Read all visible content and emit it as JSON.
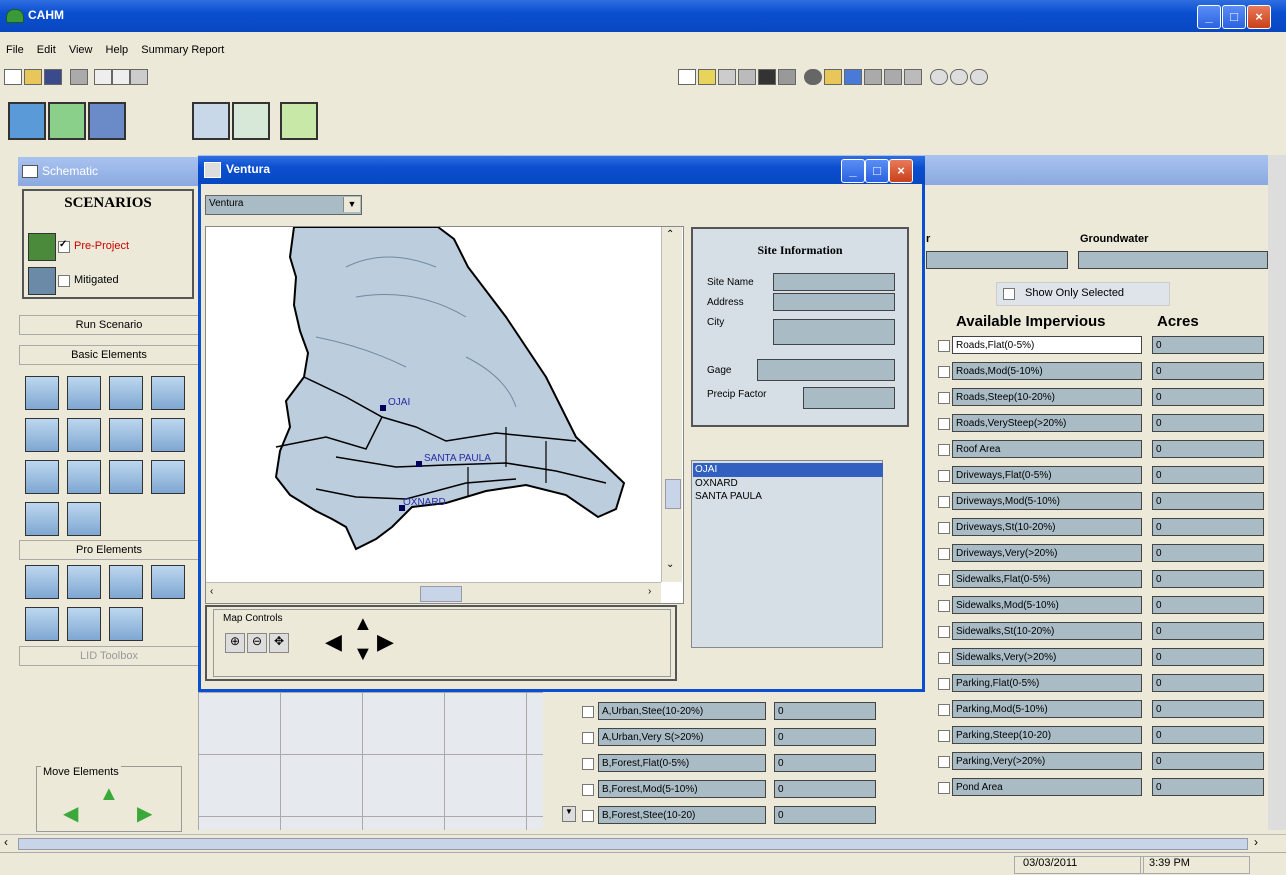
{
  "window": {
    "title": "CAHM"
  },
  "menu": [
    "File",
    "Edit",
    "View",
    "Help",
    "Summary Report"
  ],
  "left": {
    "header": "Schematic",
    "scenarios_title": "SCENARIOS",
    "scenarios": [
      {
        "label": "Pre-Project",
        "checked": true,
        "color": "#cc0000"
      },
      {
        "label": "Mitigated",
        "checked": false,
        "color": "#000000"
      }
    ],
    "run_label": "Run Scenario",
    "basic_label": "Basic Elements",
    "pro_label": "Pro Elements",
    "lid_label": "LID Toolbox",
    "move_label": "Move Elements"
  },
  "ventura": {
    "title": "Ventura",
    "dropdown_value": "Ventura",
    "site_info_title": "Site Information",
    "site_labels": [
      "Site Name",
      "Address",
      "City"
    ],
    "gage_label": "Gage",
    "precip_label": "Precip Factor",
    "map_controls_label": "Map Controls",
    "cities": [
      "OJAI",
      "OXNARD",
      "SANTA PAULA"
    ],
    "map_labels": [
      "OJAI",
      "SANTA PAULA",
      "OXNARD"
    ]
  },
  "main": {
    "col_partial": "r",
    "groundwater_label": "Groundwater",
    "show_only_selected": "Show Only Selected",
    "imperv_header": "Available Impervious",
    "acres_header": "Acres",
    "impervious": [
      "Roads,Flat(0-5%)",
      "Roads,Mod(5-10%)",
      "Roads,Steep(10-20%)",
      "Roads,VerySteep(>20%)",
      "Roof Area",
      "Driveways,Flat(0-5%)",
      "Driveways,Mod(5-10%)",
      "Driveways,St(10-20%)",
      "Driveways,Very(>20%)",
      "Sidewalks,Flat(0-5%)",
      "Sidewalks,Mod(5-10%)",
      "Sidewalks,St(10-20%)",
      "Sidewalks,Very(>20%)",
      "Parking,Flat(0-5%)",
      "Parking,Mod(5-10%)",
      "Parking,Steep(10-20)",
      "Parking,Very(>20%)",
      "Pond Area"
    ],
    "impervious_values": [
      "0",
      "0",
      "0",
      "0",
      "0",
      "0",
      "0",
      "0",
      "0",
      "0",
      "0",
      "0",
      "0",
      "0",
      "0",
      "0",
      "0",
      "0"
    ],
    "pervious": [
      "A,Urban,Stee(10-20%)",
      "A,Urban,Very S(>20%)",
      "B,Forest,Flat(0-5%)",
      "B,Forest,Mod(5-10%)",
      "B,Forest,Stee(10-20)"
    ],
    "pervious_values": [
      "0",
      "0",
      "0",
      "0",
      "0"
    ]
  },
  "status": {
    "date": "03/03/2011",
    "time": "3:39 PM"
  }
}
